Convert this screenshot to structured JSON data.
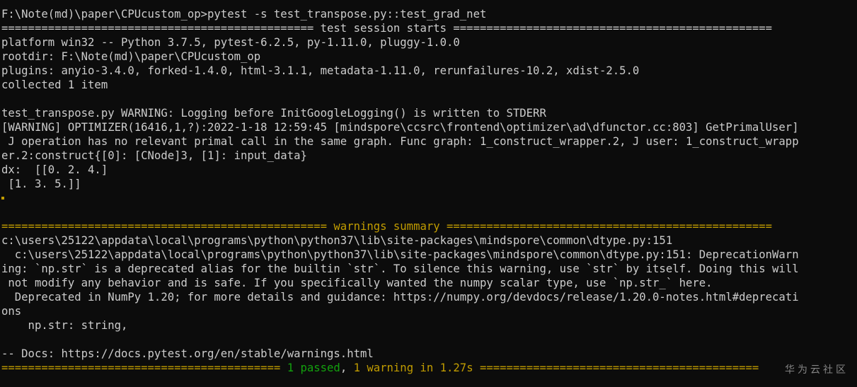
{
  "terminal": {
    "lines": [
      "F:\\Note(md)\\paper\\CPUcustom_op>pytest -s test_transpose.py::test_grad_net",
      "=============================================== test session starts ================================================",
      "platform win32 -- Python 3.7.5, pytest-6.2.5, py-1.11.0, pluggy-1.0.0",
      "rootdir: F:\\Note(md)\\paper\\CPUcustom_op",
      "plugins: anyio-3.4.0, forked-1.4.0, html-3.1.1, metadata-1.11.0, rerunfailures-10.2, xdist-2.5.0",
      "collected 1 item",
      "",
      "test_transpose.py WARNING: Logging before InitGoogleLogging() is written to STDERR",
      "[WARNING] OPTIMIZER(16416,1,?):2022-1-18 12:59:45 [mindspore\\ccsrc\\frontend\\optimizer\\ad\\dfunctor.cc:803] GetPrimalUser]",
      " J operation has no relevant primal call in the same graph. Func graph: 1_construct_wrapper.2, J user: 1_construct_wrapp",
      "er.2:construct{[0]: [CNode]3, [1]: input_data}",
      "dx:  [[0. 2. 4.]",
      " [1. 3. 5.]]"
    ],
    "warnings_header": "================================================= warnings summary =================================================",
    "warning_lines": [
      "c:\\users\\25122\\appdata\\local\\programs\\python\\python37\\lib\\site-packages\\mindspore\\common\\dtype.py:151",
      "  c:\\users\\25122\\appdata\\local\\programs\\python\\python37\\lib\\site-packages\\mindspore\\common\\dtype.py:151: DeprecationWarn",
      "ing: `np.str` is a deprecated alias for the builtin `str`. To silence this warning, use `str` by itself. Doing this will",
      " not modify any behavior and is safe. If you specifically wanted the numpy scalar type, use `np.str_` here.",
      "  Deprecated in NumPy 1.20; for more details and guidance: https://numpy.org/devdocs/release/1.20.0-notes.html#deprecati",
      "ons",
      "    np.str: string,",
      "",
      "-- Docs: https://docs.pytest.org/en/stable/warnings.html"
    ],
    "summary": {
      "prefix": "========================================== ",
      "passed": "1 passed",
      "comma": ", ",
      "warning": "1 warning",
      "in_time": " in 1.27s",
      "suffix": " =========================================="
    }
  },
  "watermark": "华为云社区",
  "colors": {
    "background": "#0c0c0c",
    "text": "#cccccc",
    "yellow": "#c19c00",
    "green": "#13a10e"
  }
}
